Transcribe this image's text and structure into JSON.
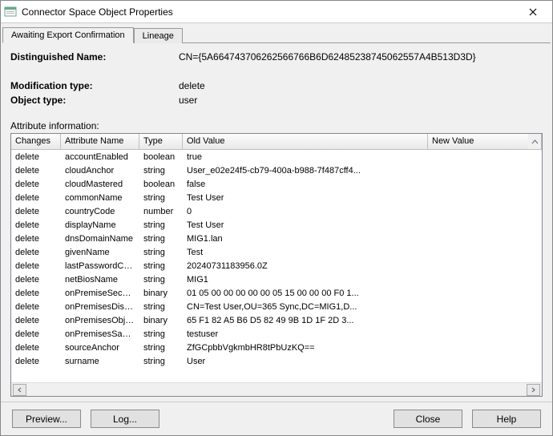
{
  "window": {
    "title": "Connector Space Object Properties"
  },
  "tabs": {
    "active": "Awaiting Export Confirmation",
    "inactive": "Lineage"
  },
  "fields": {
    "dn_label": "Distinguished Name:",
    "dn_value": "CN={5A664743706262566766B6D62485238745062557A4B513D3D}",
    "modtype_label": "Modification type:",
    "modtype_value": "delete",
    "objtype_label": "Object type:",
    "objtype_value": "user",
    "attrinfo_label": "Attribute information:"
  },
  "columns": {
    "changes": "Changes",
    "attr": "Attribute Name",
    "type": "Type",
    "oldval": "Old Value",
    "newval": "New Value"
  },
  "rows": [
    {
      "changes": "delete",
      "attr": "accountEnabled",
      "type": "boolean",
      "oldval": "true",
      "newval": ""
    },
    {
      "changes": "delete",
      "attr": "cloudAnchor",
      "type": "string",
      "oldval": "User_e02e24f5-cb79-400a-b988-7f487cff4...",
      "newval": ""
    },
    {
      "changes": "delete",
      "attr": "cloudMastered",
      "type": "boolean",
      "oldval": "false",
      "newval": ""
    },
    {
      "changes": "delete",
      "attr": "commonName",
      "type": "string",
      "oldval": "Test User",
      "newval": ""
    },
    {
      "changes": "delete",
      "attr": "countryCode",
      "type": "number",
      "oldval": "0",
      "newval": ""
    },
    {
      "changes": "delete",
      "attr": "displayName",
      "type": "string",
      "oldval": "Test User",
      "newval": ""
    },
    {
      "changes": "delete",
      "attr": "dnsDomainName",
      "type": "string",
      "oldval": "MIG1.lan",
      "newval": ""
    },
    {
      "changes": "delete",
      "attr": "givenName",
      "type": "string",
      "oldval": "Test",
      "newval": ""
    },
    {
      "changes": "delete",
      "attr": "lastPasswordCha...",
      "type": "string",
      "oldval": "20240731183956.0Z",
      "newval": ""
    },
    {
      "changes": "delete",
      "attr": "netBiosName",
      "type": "string",
      "oldval": "MIG1",
      "newval": ""
    },
    {
      "changes": "delete",
      "attr": "onPremiseSecurit...",
      "type": "binary",
      "oldval": "01 05 00 00 00 00 00 05 15 00 00 00 F0 1...",
      "newval": ""
    },
    {
      "changes": "delete",
      "attr": "onPremisesDistin...",
      "type": "string",
      "oldval": "CN=Test User,OU=365 Sync,DC=MIG1,D...",
      "newval": ""
    },
    {
      "changes": "delete",
      "attr": "onPremisesObjec...",
      "type": "binary",
      "oldval": "65 F1 82 A5 B6 D5 82 49 9B 1D 1F 2D 3...",
      "newval": ""
    },
    {
      "changes": "delete",
      "attr": "onPremisesSamA...",
      "type": "string",
      "oldval": "testuser",
      "newval": ""
    },
    {
      "changes": "delete",
      "attr": "sourceAnchor",
      "type": "string",
      "oldval": "ZfGCpbbVgkmbHR8tPbUzKQ==",
      "newval": ""
    },
    {
      "changes": "delete",
      "attr": "surname",
      "type": "string",
      "oldval": "User",
      "newval": ""
    }
  ],
  "buttons": {
    "preview": "Preview...",
    "log": "Log...",
    "close": "Close",
    "help": "Help"
  }
}
